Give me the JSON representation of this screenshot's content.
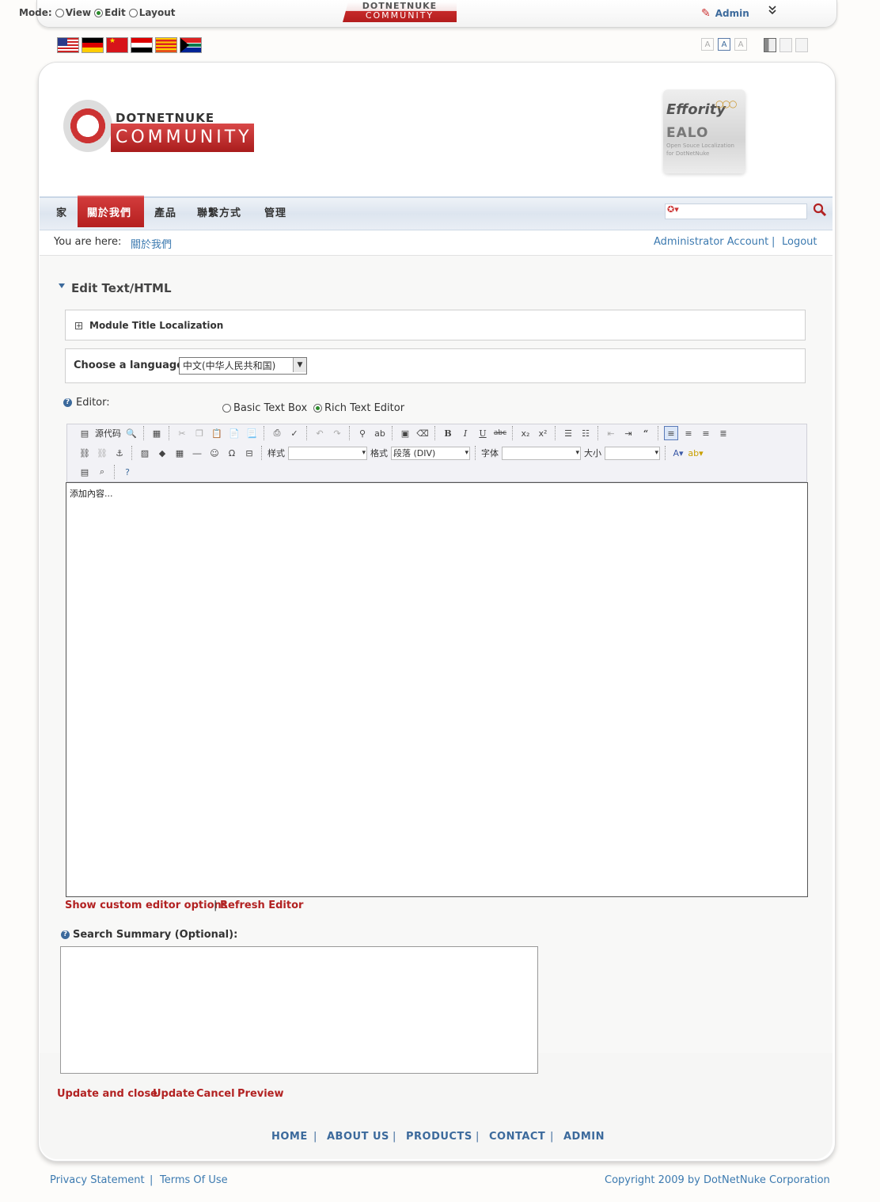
{
  "control_panel": {
    "mode_label": "Mode:",
    "modes": [
      "View",
      "Edit",
      "Layout"
    ],
    "selected_mode": "Edit",
    "logo_line1": "DOTNETNUKE",
    "logo_line2": "COMMUNITY",
    "admin_label": "Admin",
    "collapse_glyph": "»"
  },
  "languages": [
    "en-US",
    "de-DE",
    "zh-CN",
    "ar-EG",
    "ca-ES",
    "en-ZA"
  ],
  "text_size": [
    "A",
    "A",
    "A"
  ],
  "header": {
    "logo_top": "DOTNETNUKE",
    "logo_bottom": "COMMUNITY",
    "sponsor_name": "Effority",
    "sponsor_rings": "○○○",
    "sponsor_product": "EALO",
    "sponsor_tag1": "Open Souce Localization",
    "sponsor_tag2": "for DotNetNuke"
  },
  "nav": {
    "items": [
      "家",
      "關於我們",
      "產品",
      "聯繫方式",
      "管理"
    ],
    "active_index": 1
  },
  "breadcrumb": {
    "label": "You are here:",
    "current": "關於我們",
    "account": "Administrator Account",
    "separator": "|",
    "logout": "Logout"
  },
  "module": {
    "title": "Edit Text/HTML",
    "localization_title": "Module Title Localization",
    "language_label": "Choose a language:",
    "language_value": "中文(中华人民共和国)",
    "editor_label": "Editor:",
    "editor_options": [
      "Basic Text Box",
      "Rich Text Editor"
    ],
    "editor_selected": "Rich Text Editor",
    "toolbar": {
      "source_label": "源代码",
      "style_label": "样式",
      "format_label": "格式",
      "format_value": "段落 (DIV)",
      "font_label": "字体",
      "size_label": "大小"
    },
    "editor_content": "添加內容...",
    "custom_options_link": "Show custom editor options",
    "links_separator": "|",
    "refresh_link": "Refresh Editor",
    "summary_label": "Search Summary (Optional):",
    "summary_value": "",
    "actions": [
      "Update and close",
      "Update",
      "Cancel",
      "Preview"
    ]
  },
  "footer": {
    "nav": [
      "HOME",
      "ABOUT US",
      "PRODUCTS",
      "CONTACT",
      "ADMIN"
    ],
    "separator": "|",
    "privacy": "Privacy Statement",
    "terms": "Terms Of Use",
    "copyright": "Copyright 2009 by DotNetNuke Corporation"
  },
  "colors": {
    "accent_red": "#b22222",
    "link_blue": "#3c7ab0",
    "nav_active": "#c32a2a"
  }
}
